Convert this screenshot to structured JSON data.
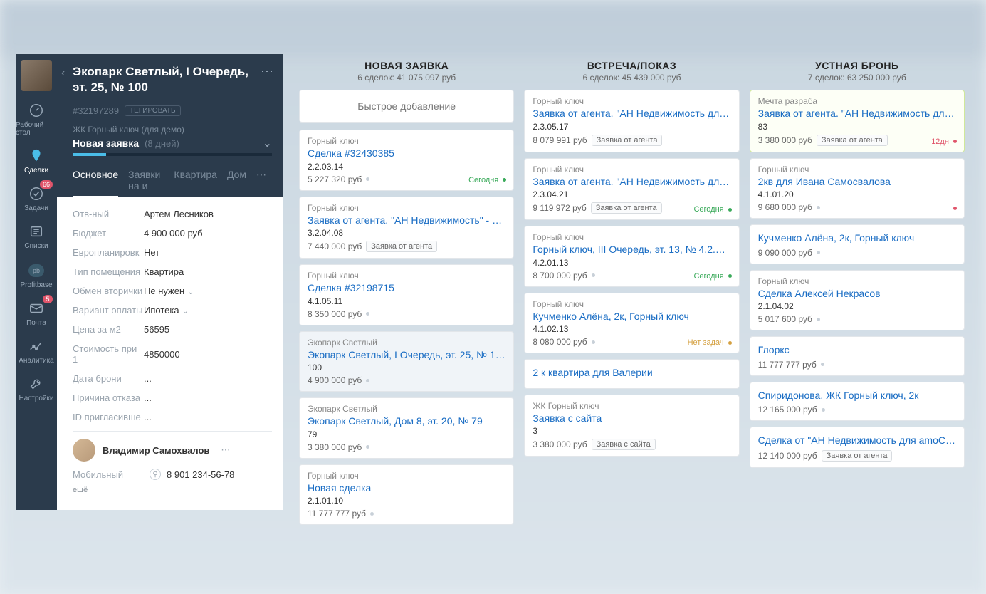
{
  "sidebar": {
    "items": [
      {
        "label": "Рабочий стол"
      },
      {
        "label": "Сделки"
      },
      {
        "label": "Задачи",
        "badge": "66"
      },
      {
        "label": "Списки"
      },
      {
        "label": "Profitbase"
      },
      {
        "label": "Почта",
        "badge": "5"
      },
      {
        "label": "Аналитика"
      },
      {
        "label": "Настройки"
      }
    ]
  },
  "detail": {
    "title": "Экопарк Светлый, I Очередь, эт. 25, № 100",
    "id": "#32197289",
    "tag_btn": "ТЕГИРОВАТЬ",
    "pipeline": "ЖК Горный ключ (для демо)",
    "stage": "Новая заявка",
    "stage_days": "(8 дней)",
    "tabs": [
      "Основное",
      "Заявки на и",
      "Квартира",
      "Дом"
    ],
    "fields": [
      {
        "label": "Отв-ный",
        "value": "Артем Лесников"
      },
      {
        "label": "Бюджет",
        "value": "4 900 000 руб"
      },
      {
        "label": "Европланировк",
        "value": "Нет"
      },
      {
        "label": "Тип помещения",
        "value": "Квартира"
      },
      {
        "label": "Обмен вторички",
        "value": "Не нужен",
        "chevron": true
      },
      {
        "label": "Вариант оплаты",
        "value": "Ипотека",
        "chevron": true
      },
      {
        "label": "Цена за м2",
        "value": "56595"
      },
      {
        "label": "Стоимость при 1",
        "value": "4850000"
      },
      {
        "label": "Дата брони",
        "value": "..."
      },
      {
        "label": "Причина отказа",
        "value": "..."
      },
      {
        "label": "ID пригласивше",
        "value": "..."
      }
    ],
    "contact": {
      "name": "Владимир Самохвалов",
      "phone_label": "Мобильный",
      "phone": "8 901 234-56-78",
      "more": "ещё"
    }
  },
  "columns": [
    {
      "title": "НОВАЯ ЗАЯВКА",
      "sub": "6 сделок: 41 075 097 руб",
      "quick_add": "Быстрое добавление",
      "cards": [
        {
          "proj": "Горный ключ",
          "title": "Сделка #32430385",
          "code": "2.2.03.14",
          "price": "5 227 320 руб",
          "dot": true,
          "status": "Сегодня",
          "status_class": "status-today"
        },
        {
          "proj": "Горный ключ",
          "title": "Заявка от агента. \"АН Недвижимость\" - Горны...",
          "code": "3.2.04.08",
          "price": "7 440 000 руб",
          "tag": "Заявка от агента"
        },
        {
          "proj": "Горный ключ",
          "title": "Сделка #32198715",
          "code": "4.1.05.11",
          "price": "8 350 000 руб",
          "dot": true
        },
        {
          "proj": "Экопарк Светлый",
          "title": "Экопарк Светлый, I Очередь, эт. 25, № 100",
          "code": "100",
          "price": "4 900 000 руб",
          "dot": true,
          "selected": true
        },
        {
          "proj": "Экопарк Светлый",
          "title": "Экопарк Светлый, Дом 8, эт. 20, № 79",
          "code": "79",
          "price": "3 380 000 руб",
          "dot": true
        },
        {
          "proj": "Горный ключ",
          "title": "Новая сделка",
          "code": "2.1.01.10",
          "price": "11 777 777 руб",
          "dot": true
        }
      ]
    },
    {
      "title": "ВСТРЕЧА/ПОКАЗ",
      "sub": "6 сделок: 45 439 000 руб",
      "cards": [
        {
          "proj": "Горный ключ",
          "title": "Заявка от агента. \"АН Недвижимость для am...",
          "code": "2.3.05.17",
          "price": "8 079 991 руб",
          "tag": "Заявка от агента"
        },
        {
          "proj": "Горный ключ",
          "title": "Заявка от агента. \"АН Недвижимость для am...",
          "code": "2.3.04.21",
          "price": "9 119 972 руб",
          "tag": "Заявка от агента",
          "status": "Сегодня",
          "status_class": "status-today"
        },
        {
          "proj": "Горный ключ",
          "title": "Горный ключ, III Очередь, эт. 13, № 4.2.01.13",
          "code": "4.2.01.13",
          "price": "8 700 000 руб",
          "dot": true,
          "status": "Сегодня",
          "status_class": "status-today"
        },
        {
          "proj": "Горный ключ",
          "title": "Кучменко Алёна, 2к, Горный ключ",
          "code": "4.1.02.13",
          "price": "8 080 000 руб",
          "dot": true,
          "status": "Нет задач",
          "status_class": "status-none"
        },
        {
          "proj": "",
          "title": "2 к квартира для Валерии",
          "code": "",
          "price": ""
        },
        {
          "proj": "ЖК Горный ключ",
          "title": "Заявка с сайта",
          "code": "3",
          "price": "3 380 000 руб",
          "tag": "Заявка с сайта"
        }
      ]
    },
    {
      "title": "УСТНАЯ БРОНЬ",
      "sub": "7 сделок: 63 250 000 руб",
      "cards": [
        {
          "proj": "Мечта разраба",
          "title": "Заявка от агента. \"АН Недвижимость для am...",
          "code": "83",
          "price": "3 380 000 руб",
          "tag": "Заявка от агента",
          "status": "12дн",
          "status_class": "status-late",
          "highlight": true
        },
        {
          "proj": "Горный ключ",
          "title": "2кв для Ивана Самосвалова",
          "code": "4.1.01.20",
          "price": "9 680 000 руб",
          "dot": true,
          "status": "",
          "status_class": "status-late",
          "status_dot": true
        },
        {
          "proj": "",
          "title": "Кучменко Алёна, 2к, Горный ключ",
          "code": "",
          "price": "9 090 000 руб",
          "dot": true
        },
        {
          "proj": "Горный ключ",
          "title": "Сделка Алексей Некрасов",
          "code": "2.1.04.02",
          "price": "5 017 600 руб",
          "dot": true
        },
        {
          "proj": "",
          "title": "Глоркс",
          "code": "",
          "price": "11 777 777 руб",
          "dot": true
        },
        {
          "proj": "",
          "title": "Спиридонова, ЖК Горный ключ, 2к",
          "code": "",
          "price": "12 165 000 руб",
          "dot": true
        },
        {
          "proj": "",
          "title": "Сделка от \"АН Недвижимость для amoCRM\" -...",
          "code": "",
          "price": "12 140 000 руб",
          "tag": "Заявка от агента"
        }
      ]
    }
  ]
}
